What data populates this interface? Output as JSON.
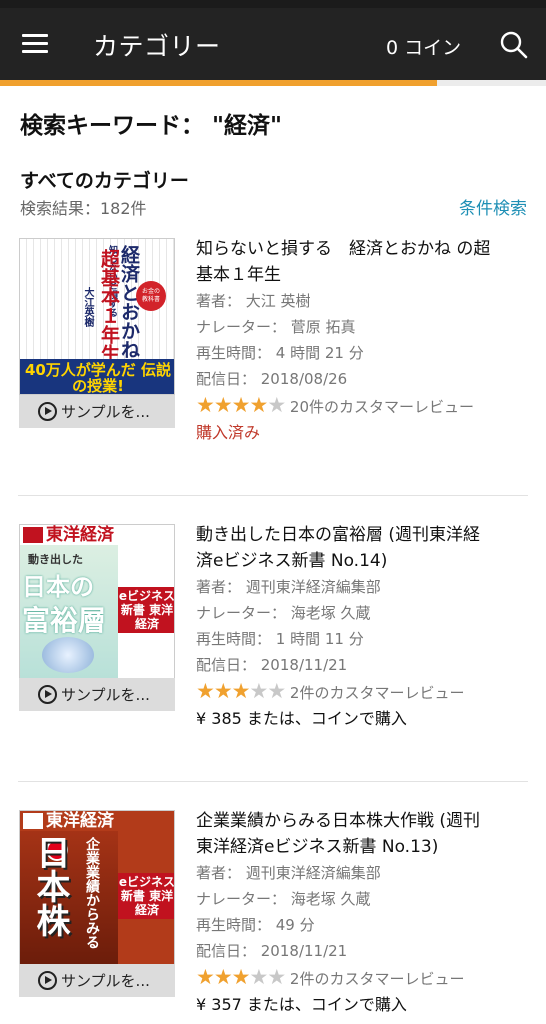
{
  "appbar": {
    "title": "カテゴリー",
    "coins": "0 コイン",
    "menu_icon": "hamburger-menu-icon",
    "search_icon": "search-icon",
    "accent": "#f0a02e",
    "loading_progress": 0.8
  },
  "header": {
    "keyword": "検索キーワード： \"経済\"",
    "category_title": "すべてのカテゴリー",
    "result_count": "検索結果：182件",
    "filter_link": "条件検索"
  },
  "sample_label": "サンプルを...",
  "items": [
    {
      "title": "知らないと損する　経済とおかね の超基本１年生",
      "author": "著者： 大江 英樹",
      "narrator": "ナレーター： 菅原 拓真",
      "duration": "再生時間： 4 時間 21 分",
      "date": "配信日： 2018/08/26",
      "rating": 4,
      "rating_max": 5,
      "reviews": "20件のカスタマーレビュー",
      "status": "購入済み",
      "cover": {
        "title_a": "経済とおかねの",
        "title_b": "超基本１年生",
        "author": "大江英樹",
        "band": "40万人が学んだ 伝説の授業!",
        "small_top": "知らないと損する"
      }
    },
    {
      "title": "動き出した日本の富裕層 (週刊東洋経済eビジネス新書 No.14)",
      "author": "著者： 週刊東洋経済編集部",
      "narrator": "ナレーター： 海老塚 久蔵",
      "duration": "再生時間： 1 時間 11 分",
      "date": "配信日： 2018/11/21",
      "rating": 3,
      "rating_max": 5,
      "reviews": "2件のカスタマーレビュー",
      "price": "¥ 385 または、コインで購入",
      "cover": {
        "masthead": "東洋経済",
        "line1": "動き出した",
        "line2": "日本の",
        "line3": "富裕層",
        "ebook": "eビジネス 新書 東洋経済"
      }
    },
    {
      "title": "企業業績からみる日本株大作戦 (週刊東洋経済eビジネス新書 No.13)",
      "author": "著者： 週刊東洋経済編集部",
      "narrator": "ナレーター： 海老塚 久蔵",
      "duration": "再生時間： 49 分",
      "date": "配信日： 2018/11/21",
      "rating": 3,
      "rating_max": 5,
      "reviews": "2件のカスタマーレビュー",
      "price": "¥ 357 または、コインで購入",
      "cover": {
        "masthead": "東洋経済",
        "big": "日本株",
        "sub": "企業業績からみる",
        "ebook": "eビジネス 新書 東洋経済"
      }
    }
  ]
}
